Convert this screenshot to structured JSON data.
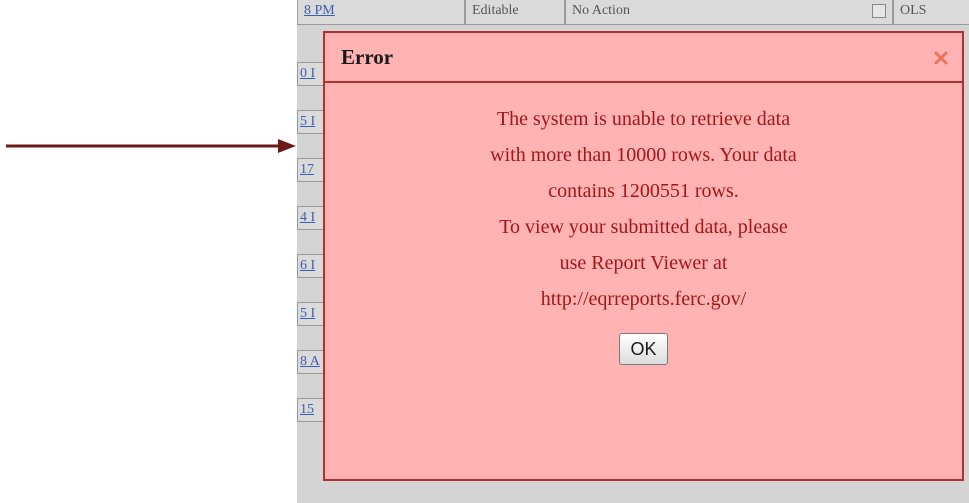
{
  "background": {
    "top_row": {
      "time_link": "8 PM",
      "status": "Editable",
      "action_select": "No Action",
      "trailing": "OLS"
    },
    "row_links": [
      "0 I",
      "5 I",
      "17",
      "4 I",
      "6 I",
      "5 I",
      "8 A",
      "15"
    ]
  },
  "dialog": {
    "title": "Error",
    "message_lines": [
      "The system is unable to retrieve data",
      "with more than 10000 rows. Your data",
      "contains 1200551 rows.",
      "To view your submitted data, please",
      "use Report Viewer at",
      "http://eqrreports.ferc.gov/"
    ],
    "ok_label": "OK",
    "close_icon": "close-x-icon"
  },
  "colors": {
    "dialog_bg": "#ffb3b3",
    "dialog_border": "#b33030",
    "message_text": "#a4161a",
    "arrow": "#6b1a1a",
    "overlay": "#d4d4d4"
  }
}
